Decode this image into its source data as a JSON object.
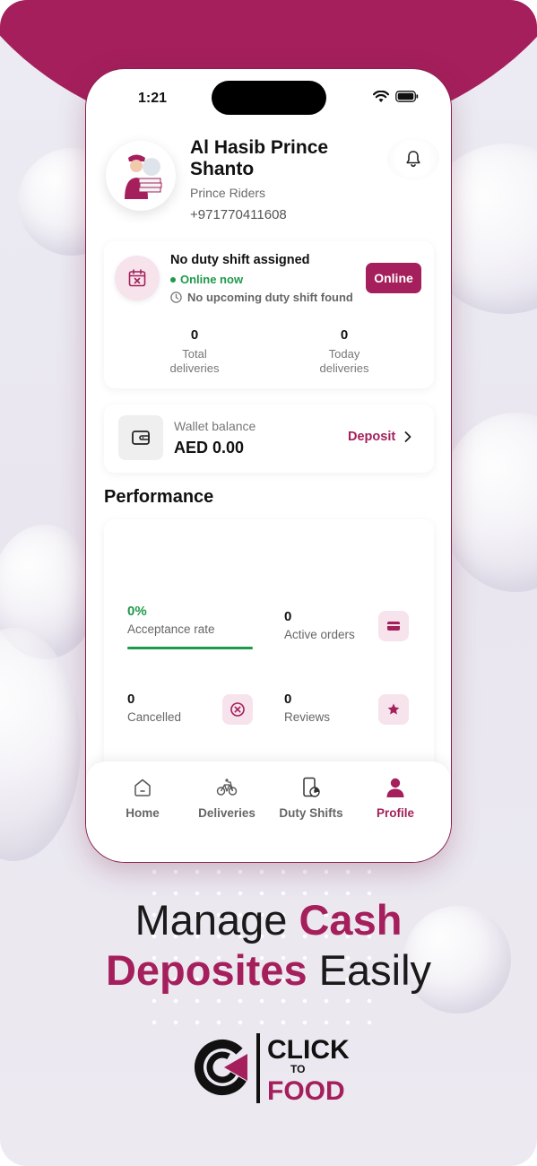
{
  "status_bar": {
    "time": "1:21"
  },
  "profile": {
    "name": "Al Hasib Prince Shanto",
    "company": "Prince Riders",
    "phone": "+971770411608"
  },
  "shift": {
    "title": "No duty shift assigned",
    "status": "Online now",
    "upcoming": "No upcoming duty shift found",
    "button": "Online",
    "total_deliveries_value": "0",
    "total_deliveries_label": "Total deliveries",
    "today_deliveries_value": "0",
    "today_deliveries_label": "Today deliveries"
  },
  "wallet": {
    "label": "Wallet balance",
    "amount": "AED 0.00",
    "deposit": "Deposit"
  },
  "performance": {
    "title": "Performance",
    "acceptance_value": "0%",
    "acceptance_label": "Acceptance rate",
    "acceptance_fraction": 1.0,
    "active_value": "0",
    "active_label": "Active orders",
    "cancelled_value": "0",
    "cancelled_label": "Cancelled",
    "reviews_value": "0",
    "reviews_label": "Reviews"
  },
  "nav": {
    "items": [
      {
        "label": "Home",
        "icon": "home-icon"
      },
      {
        "label": "Deliveries",
        "icon": "bicycle-icon"
      },
      {
        "label": "Duty Shifts",
        "icon": "duty-shift-icon"
      },
      {
        "label": "Profile",
        "icon": "profile-icon"
      }
    ],
    "active": "Profile"
  },
  "promo": {
    "line1_normal": "Manage ",
    "line1_highlight": "Cash",
    "line2_highlight": "Deposites",
    "line2_normal": " Easily"
  },
  "brand": {
    "logo_text_top": "CLICK",
    "logo_text_mid": "TO",
    "logo_text_bottom": "FOOD"
  },
  "colors": {
    "brand": "#a41f5b",
    "success": "#1f9a4a"
  }
}
